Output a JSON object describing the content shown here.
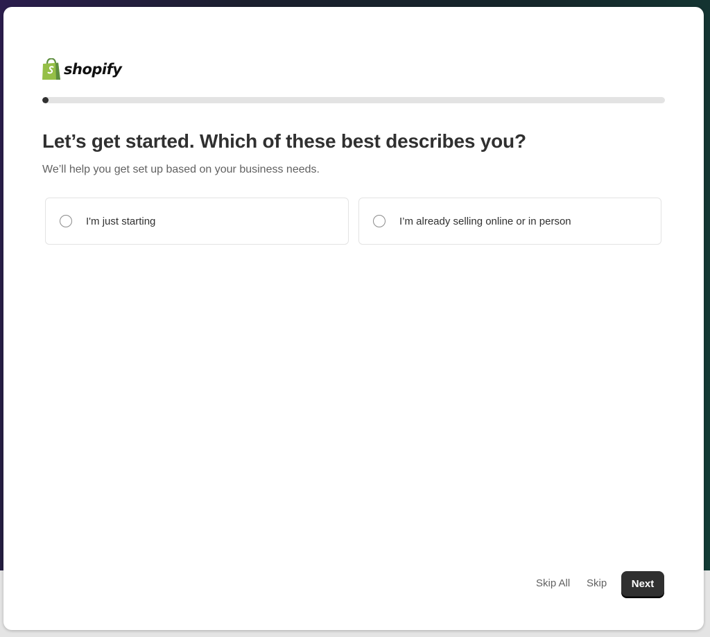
{
  "brand": {
    "name": "shopify",
    "icon": "shopify-bag-icon",
    "color": "#95bf47"
  },
  "progress": {
    "fraction": 0.01
  },
  "question": {
    "title": "Let’s get started. Which of these best describes you?",
    "subtitle": "We’ll help you get set up based on your business needs."
  },
  "options": [
    {
      "label": "I'm just starting",
      "selected": false
    },
    {
      "label": "I’m already selling online or in person",
      "selected": false
    }
  ],
  "footer": {
    "skip_all_label": "Skip All",
    "skip_label": "Skip",
    "next_label": "Next"
  },
  "colors": {
    "text_primary": "#303030",
    "text_secondary": "#616161",
    "button_bg": "#303030",
    "progress_track": "#e3e3e3"
  }
}
